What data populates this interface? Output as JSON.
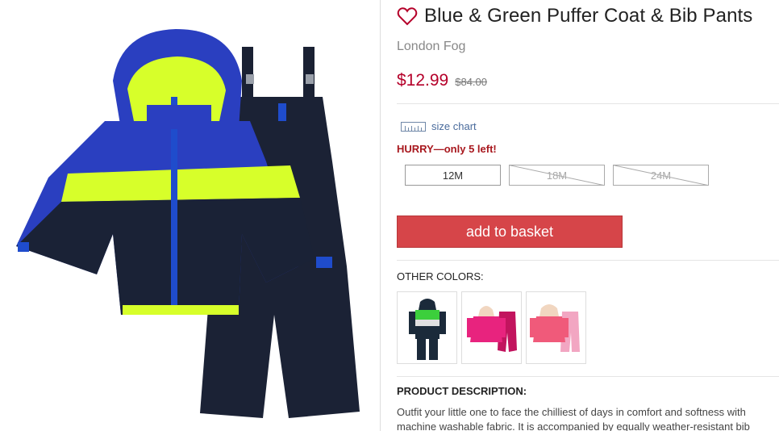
{
  "product": {
    "title": "Blue & Green Puffer Coat & Bib Pants",
    "brand": "London Fog",
    "price": "$12.99",
    "original_price": "$84.00",
    "wishlist_icon": "heart-outline-icon"
  },
  "size_chart": {
    "label": "size chart",
    "icon": "ruler-icon"
  },
  "stock_message": "HURRY—only 5 left!",
  "sizes": [
    {
      "label": "12M",
      "available": true
    },
    {
      "label": "18M",
      "available": false
    },
    {
      "label": "24M",
      "available": false
    }
  ],
  "add_to_basket_label": "add to basket",
  "other_colors": {
    "label": "OTHER COLORS:",
    "options": [
      {
        "name": "green-navy"
      },
      {
        "name": "fuchsia"
      },
      {
        "name": "pink-floral"
      }
    ]
  },
  "description": {
    "label": "PRODUCT DESCRIPTION:",
    "line1": "Outfit your little one to face the chilliest of days in comfort and softness with",
    "line2": "machine washable fabric. It is accompanied by equally weather-resistant bib"
  },
  "colors": {
    "price": "#b5002a",
    "button": "#d64549",
    "hurry": "#a8181e",
    "link": "#4a6b9c"
  }
}
